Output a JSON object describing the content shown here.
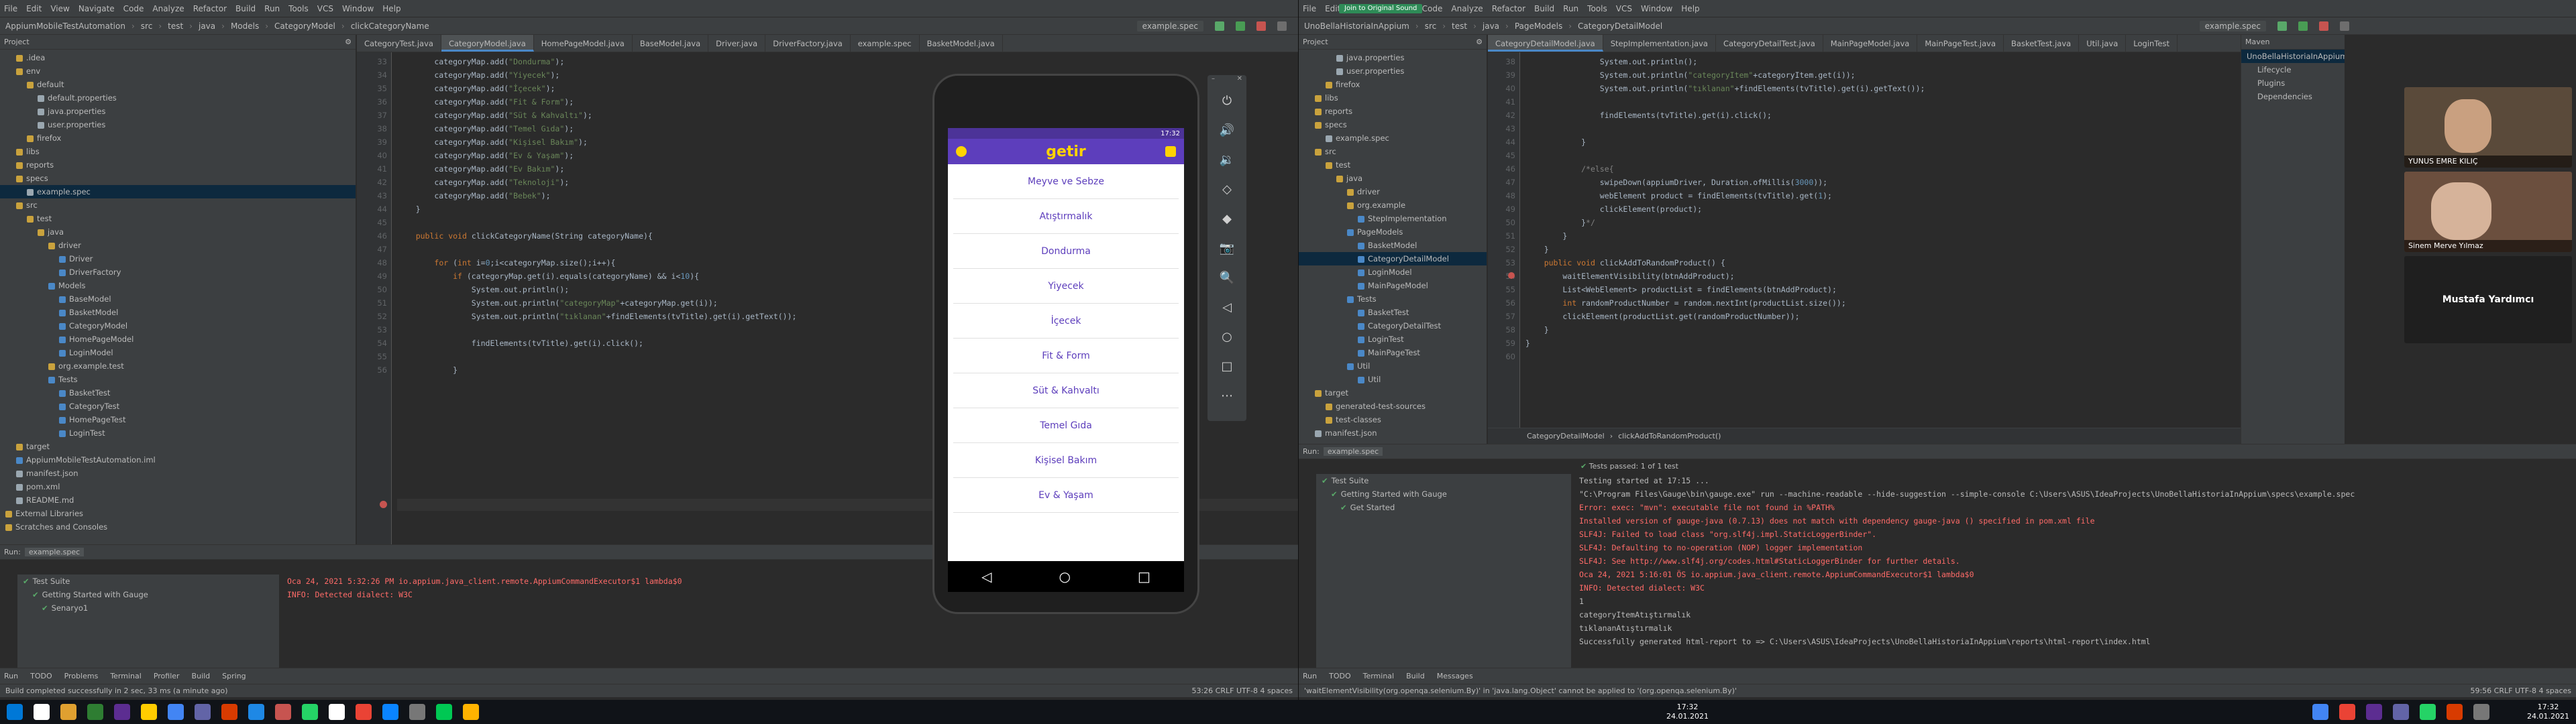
{
  "left": {
    "menu": [
      "File",
      "Edit",
      "View",
      "Navigate",
      "Code",
      "Analyze",
      "Refactor",
      "Build",
      "Run",
      "Tools",
      "VCS",
      "Window",
      "Help"
    ],
    "title": "AppiumMobileTestAutomation - CategoryModel.java",
    "crumbs": [
      "AppiumMobileTestAutomation",
      "src",
      "test",
      "java",
      "Models",
      "CategoryModel",
      "clickCategoryName"
    ],
    "run_config": "example.spec",
    "project_label": "Project",
    "tree": [
      {
        "t": ".idea",
        "d": 1
      },
      {
        "t": "env",
        "d": 1
      },
      {
        "t": "default",
        "d": 2
      },
      {
        "t": "default.properties",
        "d": 3
      },
      {
        "t": "java.properties",
        "d": 3
      },
      {
        "t": "user.properties",
        "d": 3
      },
      {
        "t": "firefox",
        "d": 2
      },
      {
        "t": "libs",
        "d": 1
      },
      {
        "t": "reports",
        "d": 1
      },
      {
        "t": "specs",
        "d": 1
      },
      {
        "t": "example.spec",
        "d": 2,
        "sel": true
      },
      {
        "t": "src",
        "d": 1
      },
      {
        "t": "test",
        "d": 2
      },
      {
        "t": "java",
        "d": 3
      },
      {
        "t": "driver",
        "d": 4
      },
      {
        "t": "Driver",
        "d": 5
      },
      {
        "t": "DriverFactory",
        "d": 5
      },
      {
        "t": "Models",
        "d": 4
      },
      {
        "t": "BaseModel",
        "d": 5
      },
      {
        "t": "BasketModel",
        "d": 5
      },
      {
        "t": "CategoryModel",
        "d": 5
      },
      {
        "t": "HomePageModel",
        "d": 5
      },
      {
        "t": "LoginModel",
        "d": 5
      },
      {
        "t": "org.example.test",
        "d": 4
      },
      {
        "t": "Tests",
        "d": 4
      },
      {
        "t": "BasketTest",
        "d": 5
      },
      {
        "t": "CategoryTest",
        "d": 5
      },
      {
        "t": "HomePageTest",
        "d": 5
      },
      {
        "t": "LoginTest",
        "d": 5
      },
      {
        "t": "target",
        "d": 1
      },
      {
        "t": "AppiumMobileTestAutomation.iml",
        "d": 1
      },
      {
        "t": "manifest.json",
        "d": 1
      },
      {
        "t": "pom.xml",
        "d": 1
      },
      {
        "t": "README.md",
        "d": 1
      },
      {
        "t": "External Libraries",
        "d": 0
      },
      {
        "t": "Scratches and Consoles",
        "d": 0
      }
    ],
    "tabs": [
      "CategoryTest.java",
      "CategoryModel.java",
      "HomePageModel.java",
      "BaseModel.java",
      "Driver.java",
      "DriverFactory.java",
      "example.spec",
      "BasketModel.java"
    ],
    "active_tab": 1,
    "line_numbers": [
      "33",
      "34",
      "35",
      "36",
      "37",
      "38",
      "39",
      "40",
      "41",
      "42",
      "43",
      "44",
      "45",
      "46",
      "47",
      "48",
      "49",
      "50",
      "51",
      "52",
      "53",
      "54",
      "55",
      "56"
    ],
    "code": [
      "        categoryMap.add(\"Dondurma\");",
      "        categoryMap.add(\"Yiyecek\");",
      "        categoryMap.add(\"İçecek\");",
      "        categoryMap.add(\"Fit & Form\");",
      "        categoryMap.add(\"Süt & Kahvaltı\");",
      "        categoryMap.add(\"Temel Gıda\");",
      "        categoryMap.add(\"Kişisel Bakım\");",
      "        categoryMap.add(\"Ev & Yaşam\");",
      "        categoryMap.add(\"Ev Bakım\");",
      "        categoryMap.add(\"Teknoloji\");",
      "        categoryMap.add(\"Bebek\");",
      "    }",
      "",
      "    public void clickCategoryName(String categoryName){",
      "",
      "        for (int i=0;i<categoryMap.size();i++){",
      "            if (categoryMap.get(i).equals(categoryName) && i<10){",
      "                System.out.println();",
      "                System.out.println(\"categoryMap\"+categoryMap.get(i));",
      "                System.out.println(\"tıklanan\"+findElements(tvTitle).get(i).getText());",
      "",
      "                findElements(tvTitle).get(i).click();",
      "",
      "            }"
    ],
    "run_header": "example.spec",
    "run_tree": [
      "Test Suite",
      "Getting Started with Gauge",
      "Senaryo1"
    ],
    "console": [
      "Oca 24, 2021 5:32:26 PM io.appium.java_client.remote.AppiumCommandExecutor$1 lambda$0",
      "INFO: Detected dialect: W3C"
    ],
    "bottom_tabs": [
      "Run",
      "TODO",
      "Problems",
      "Terminal",
      "Profiler",
      "Build",
      "Spring"
    ],
    "status": "Build completed successfully in 2 sec, 33 ms (a minute ago)",
    "status_right": "53:26  CRLF  UTF-8  4 spaces"
  },
  "phone": {
    "time": "17:32",
    "brand": "getir",
    "categories": [
      "Meyve ve Sebze",
      "Atıştırmalık",
      "Dondurma",
      "Yiyecek",
      "İçecek",
      "Fit & Form",
      "Süt & Kahvaltı",
      "Temel Gıda",
      "Kişisel Bakım",
      "Ev & Yaşam"
    ],
    "nav": [
      "◁",
      "○",
      "□"
    ]
  },
  "emulator_tools": [
    "⏻",
    "🔊",
    "🔉",
    "◇",
    "◆",
    "📷",
    "🔍",
    "◁",
    "○",
    "□",
    "⋯"
  ],
  "right": {
    "menu": [
      "File",
      "Edit",
      "View",
      "Navigate",
      "Code",
      "Analyze",
      "Refactor",
      "Build",
      "Run",
      "Tools",
      "VCS",
      "Window",
      "Help"
    ],
    "title": "UnoBellaHistoriaInAppium - CategoryDetailModel.java",
    "crumbs": [
      "UnoBellaHistoriaInAppium",
      "src",
      "test",
      "java",
      "PageModels",
      "CategoryDetailModel"
    ],
    "run_config": "example.spec",
    "project_label": "Project",
    "tree": [
      {
        "t": "java.properties",
        "d": 3
      },
      {
        "t": "user.properties",
        "d": 3
      },
      {
        "t": "firefox",
        "d": 2
      },
      {
        "t": "libs",
        "d": 1
      },
      {
        "t": "reports",
        "d": 1
      },
      {
        "t": "specs",
        "d": 1
      },
      {
        "t": "example.spec",
        "d": 2
      },
      {
        "t": "src",
        "d": 1
      },
      {
        "t": "test",
        "d": 2
      },
      {
        "t": "java",
        "d": 3
      },
      {
        "t": "driver",
        "d": 4
      },
      {
        "t": "org.example",
        "d": 4
      },
      {
        "t": "StepImplementation",
        "d": 5
      },
      {
        "t": "PageModels",
        "d": 4
      },
      {
        "t": "BasketModel",
        "d": 5
      },
      {
        "t": "CategoryDetailModel",
        "d": 5,
        "sel": true
      },
      {
        "t": "LoginModel",
        "d": 5
      },
      {
        "t": "MainPageModel",
        "d": 5
      },
      {
        "t": "Tests",
        "d": 4
      },
      {
        "t": "BasketTest",
        "d": 5
      },
      {
        "t": "CategoryDetailTest",
        "d": 5
      },
      {
        "t": "LoginTest",
        "d": 5
      },
      {
        "t": "MainPageTest",
        "d": 5
      },
      {
        "t": "Util",
        "d": 4
      },
      {
        "t": "Util",
        "d": 5
      },
      {
        "t": "target",
        "d": 1
      },
      {
        "t": "generated-test-sources",
        "d": 2
      },
      {
        "t": "test-classes",
        "d": 2
      },
      {
        "t": "manifest.json",
        "d": 1
      }
    ],
    "tabs": [
      "CategoryDetailModel.java",
      "StepImplementation.java",
      "CategoryDetailTest.java",
      "MainPageModel.java",
      "MainPageTest.java",
      "BasketTest.java",
      "Util.java",
      "LoginTest"
    ],
    "active_tab": 0,
    "line_numbers": [
      "38",
      "39",
      "40",
      "41",
      "42",
      "43",
      "44",
      "45",
      "46",
      "47",
      "48",
      "49",
      "50",
      "51",
      "52",
      "53",
      "54",
      "55",
      "56",
      "57",
      "58",
      "59",
      "60"
    ],
    "code": [
      "                System.out.println();",
      "                System.out.println(\"categoryItem\"+categoryItem.get(i));",
      "                System.out.println(\"tıklanan\"+findElements(tvTitle).get(i).getText());",
      "",
      "                findElements(tvTitle).get(i).click();",
      "",
      "            }",
      "",
      "            /*else{",
      "                swipeDown(appiumDriver, Duration.ofMillis(3000));",
      "                webElement product = findElements(tvTitle).get(1);",
      "                clickElement(product);",
      "            }*/",
      "        }",
      "    }",
      "    public void clickAddToRandomProduct() {",
      "        waitElementVisibility(btnAddProduct);",
      "        List<WebElement> productList = findElements(btnAddProduct);",
      "        int randomProductNumber = random.nextInt(productList.size());",
      "        clickElement(productList.get(randomProductNumber));",
      "    }",
      "}",
      ""
    ],
    "editor_crumb": [
      "CategoryDetailModel",
      "clickAddToRandomProduct()"
    ],
    "maven_label": "Maven",
    "maven_items": [
      "UnoBellaHistoriaInAppium",
      "Lifecycle",
      "Plugins",
      "Dependencies"
    ],
    "run_header": "example.spec",
    "run_tree": [
      "Test Suite",
      "Getting Started with Gauge",
      "Get Started"
    ],
    "tests_passed": "Tests passed: 1 of 1 test",
    "console": [
      "Testing started at 17:15 ...",
      "\"C:\\Program Files\\Gauge\\bin\\gauge.exe\" run --machine-readable --hide-suggestion --simple-console C:\\Users\\ASUS\\IdeaProjects\\UnoBellaHistoriaInAppium\\specs\\example.spec",
      "Error: exec: \"mvn\": executable file not found in %PATH%",
      "Installed version of gauge-java (0.7.13) does not match with dependency gauge-java () specified in pom.xml file",
      "SLF4J: Failed to load class \"org.slf4j.impl.StaticLoggerBinder\".",
      "SLF4J: Defaulting to no-operation (NOP) logger implementation",
      "SLF4J: See http://www.slf4j.org/codes.html#StaticLoggerBinder for further details.",
      "Oca 24, 2021 5:16:01 ÖS io.appium.java_client.remote.AppiumCommandExecutor$1 lambda$0",
      "INFO: Detected dialect: W3C",
      "1",
      "categoryItemAtıştırmalık",
      "tıklananAtıştırmalık",
      "Successfully generated html-report to => C:\\Users\\ASUS\\IdeaProjects\\UnoBellaHistoriaInAppium\\reports\\html-report\\index.html"
    ],
    "bottom_tabs": [
      "Run",
      "TODO",
      "Terminal",
      "Build",
      "Messages"
    ],
    "status": "'waitElementVisibility(org.openqa.selenium.By)' in 'java.lang.Object' cannot be applied to '(org.openqa.selenium.By)'",
    "status_right": "59:56  CRLF  UTF-8  4 spaces"
  },
  "meeting": {
    "banner": "Join to Original Sound",
    "participants": [
      "YUNUS EMRE KILIÇ",
      "Sinem Merve Yılmaz",
      "Mustafa Yardımcı"
    ]
  },
  "taskbar": {
    "time": "17:32",
    "date": "24.01.2021",
    "time2": "17:32",
    "date2": "24.01.2021"
  }
}
